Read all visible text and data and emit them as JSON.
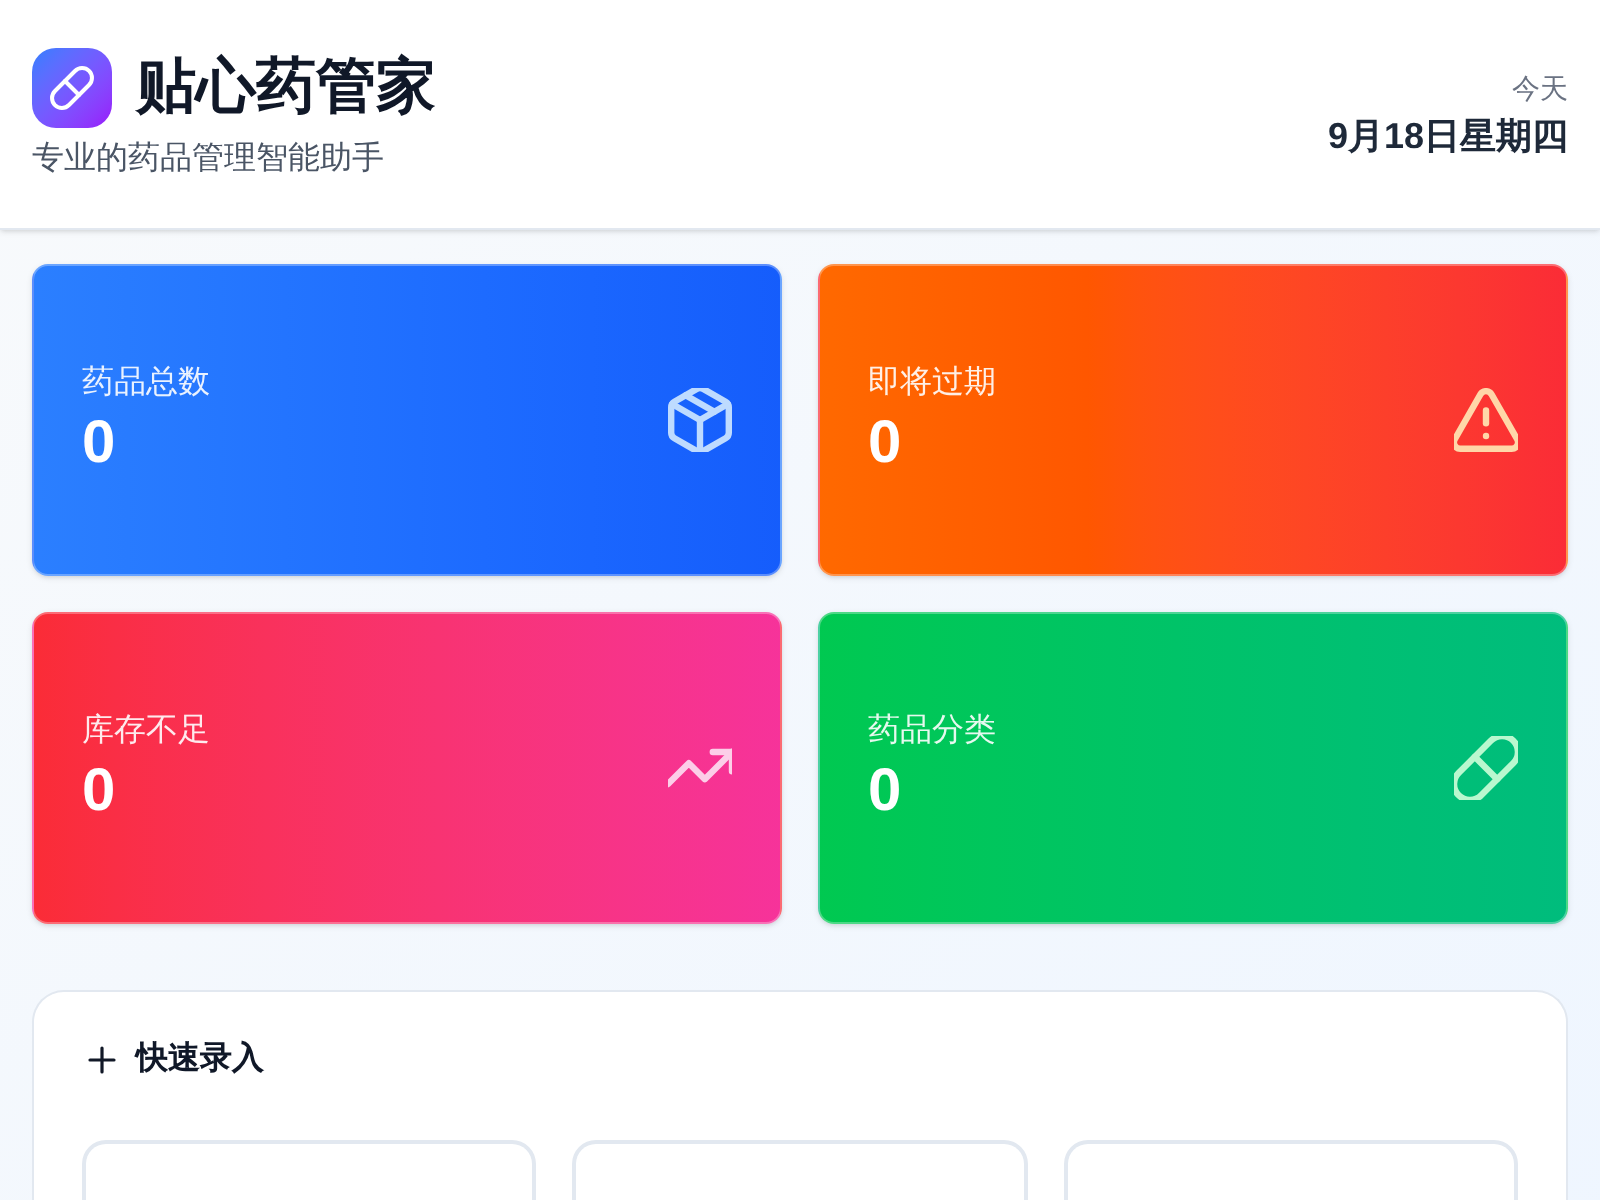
{
  "header": {
    "app_name": "贴心药管家",
    "subtitle": "专业的药品管理智能助手",
    "date_label": "今天",
    "date": "9月18日星期四"
  },
  "stats": [
    {
      "kind": "total",
      "label": "药品总数",
      "value": "0"
    },
    {
      "kind": "expiring",
      "label": "即将过期",
      "value": "0"
    },
    {
      "kind": "low_stock",
      "label": "库存不足",
      "value": "0"
    },
    {
      "kind": "categories",
      "label": "药品分类",
      "value": "0"
    }
  ],
  "quick_entry": {
    "title": "快速录入"
  }
}
